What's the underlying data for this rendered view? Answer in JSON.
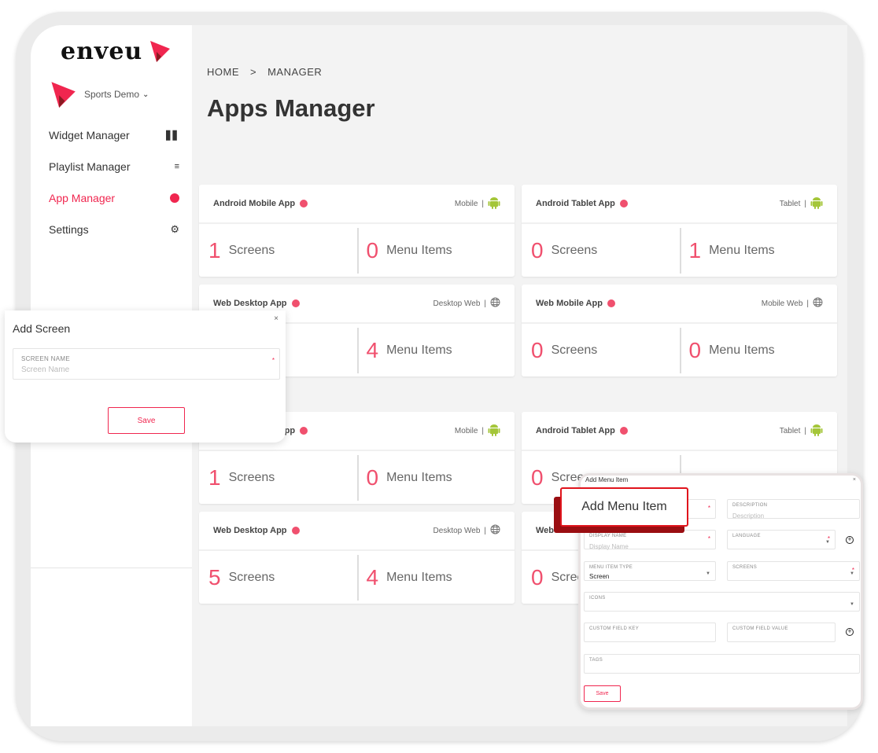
{
  "sidebar": {
    "logo": "enveu",
    "tenant": "Sports Demo",
    "items": [
      {
        "label": "Widget Manager",
        "icon": "widget-icon",
        "active": false
      },
      {
        "label": "Playlist Manager",
        "icon": "playlist-icon",
        "active": false
      },
      {
        "label": "App Manager",
        "icon": "palette-icon",
        "active": true
      },
      {
        "label": "Settings",
        "icon": "gear-icon",
        "active": false
      }
    ]
  },
  "breadcrumb": {
    "home": "HOME",
    "sep": ">",
    "current": "MANAGER"
  },
  "page_title": "Apps Manager",
  "colors": {
    "accent": "#f0264f",
    "android": "#a4c639"
  },
  "cards": [
    {
      "title": "Android Mobile App",
      "platform": "Mobile",
      "platform_icon": "android-icon",
      "screens": "1",
      "screens_label": "Screens",
      "menu": "0",
      "menu_label": "Menu Items"
    },
    {
      "title": "Android Tablet App",
      "platform": "Tablet",
      "platform_icon": "android-icon",
      "screens": "0",
      "screens_label": "Screens",
      "menu": "1",
      "menu_label": "Menu Items"
    },
    {
      "title": "Web Desktop App",
      "platform": "Desktop Web",
      "platform_icon": "globe-icon",
      "screens": "",
      "screens_label": "",
      "menu": "4",
      "menu_label": "Menu Items"
    },
    {
      "title": "Web Mobile App",
      "platform": "Mobile Web",
      "platform_icon": "globe-icon",
      "screens": "0",
      "screens_label": "Screens",
      "menu": "0",
      "menu_label": "Menu Items"
    },
    {
      "title": "Android Mobile App",
      "platform": "Mobile",
      "platform_icon": "android-icon",
      "screens": "1",
      "screens_label": "Screens",
      "menu": "0",
      "menu_label": "Menu Items"
    },
    {
      "title": "Android Tablet App",
      "platform": "Tablet",
      "platform_icon": "android-icon",
      "screens": "0",
      "screens_label": "Screens",
      "menu": "",
      "menu_label": ""
    },
    {
      "title": "Web Desktop App",
      "platform": "Desktop Web",
      "platform_icon": "globe-icon",
      "screens": "5",
      "screens_label": "Screens",
      "menu": "4",
      "menu_label": "Menu Items"
    },
    {
      "title": "Web Mobile App",
      "platform": "",
      "platform_icon": "",
      "screens": "0",
      "screens_label": "Screens",
      "menu": "",
      "menu_label": ""
    }
  ],
  "add_screen": {
    "title": "Add Screen",
    "close": "×",
    "field_label": "SCREEN NAME",
    "placeholder": "Screen Name",
    "required": "*",
    "save": "Save"
  },
  "add_menu_item": {
    "callout": "Add Menu Item",
    "title": "Add Menu Item",
    "close": "×",
    "fields": {
      "description": {
        "label": "DESCRIPTION",
        "placeholder": "Description"
      },
      "display_name": {
        "label": "DISPLAY NAME",
        "placeholder": "Display Name"
      },
      "language": {
        "label": "LANGUAGE"
      },
      "menu_item_type": {
        "label": "MENU ITEM TYPE",
        "value": "Screen"
      },
      "screens": {
        "label": "SCREENS"
      },
      "icons": {
        "label": "ICONS"
      },
      "custom_field_key": {
        "label": "CUSTOM FIELD KEY"
      },
      "custom_field_value": {
        "label": "CUSTOM FIELD VALUE"
      },
      "tags": {
        "label": "TAGS"
      }
    },
    "required": "*",
    "save": "Save"
  }
}
